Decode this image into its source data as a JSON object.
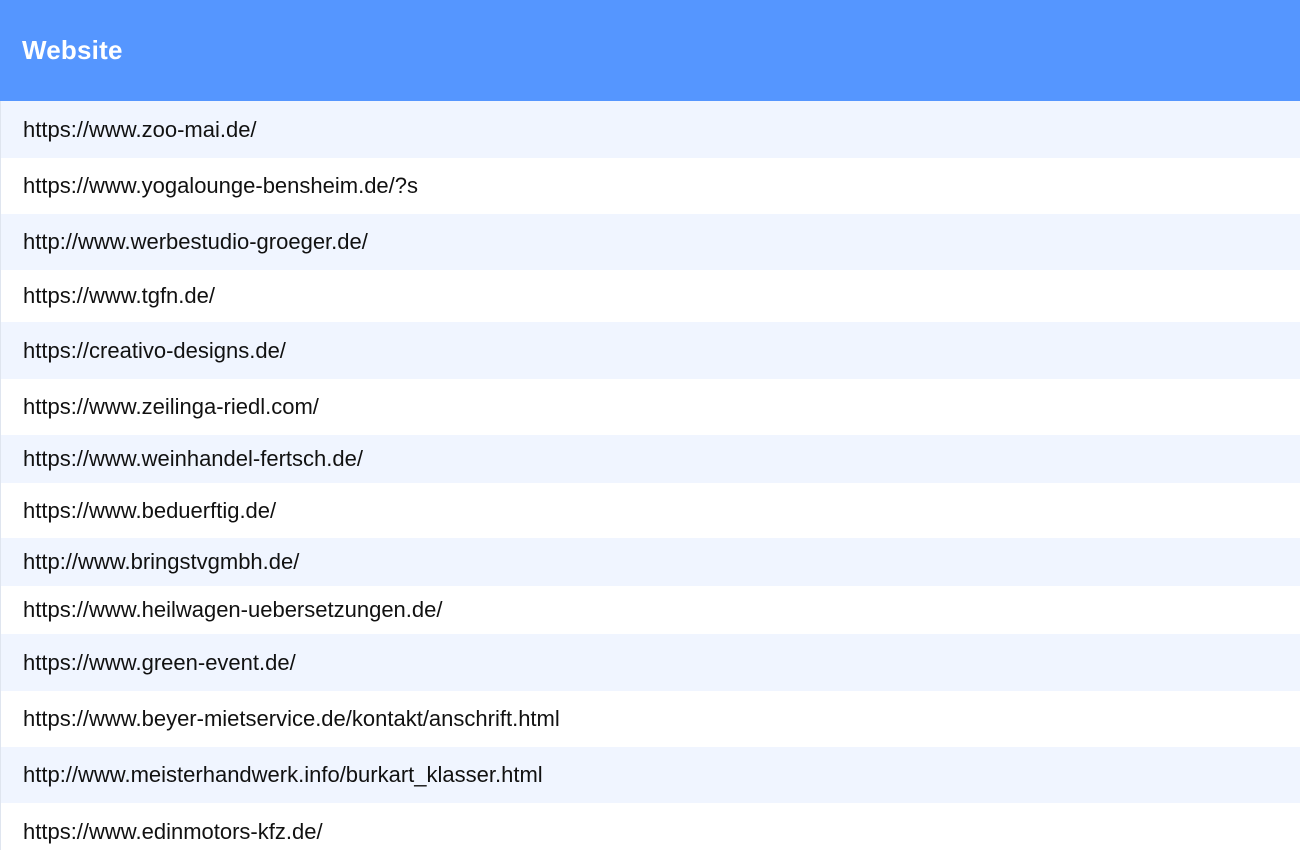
{
  "table": {
    "header": {
      "label": "Website"
    },
    "rows": [
      "https://www.zoo-mai.de/",
      "https://www.yogalounge-bensheim.de/?s",
      "http://www.werbestudio-groeger.de/",
      "https://www.tgfn.de/",
      "https://creativo-designs.de/",
      "https://www.zeilinga-riedl.com/",
      "https://www.weinhandel-fertsch.de/",
      "https://www.beduerftig.de/",
      "http://www.bringstvgmbh.de/",
      "https://www.heilwagen-uebersetzungen.de/",
      "https://www.green-event.de/",
      "https://www.beyer-mietservice.de/kontakt/anschrift.html",
      "http://www.meisterhandwerk.info/burkart_klasser.html",
      "https://www.edinmotors-kfz.de/"
    ]
  }
}
